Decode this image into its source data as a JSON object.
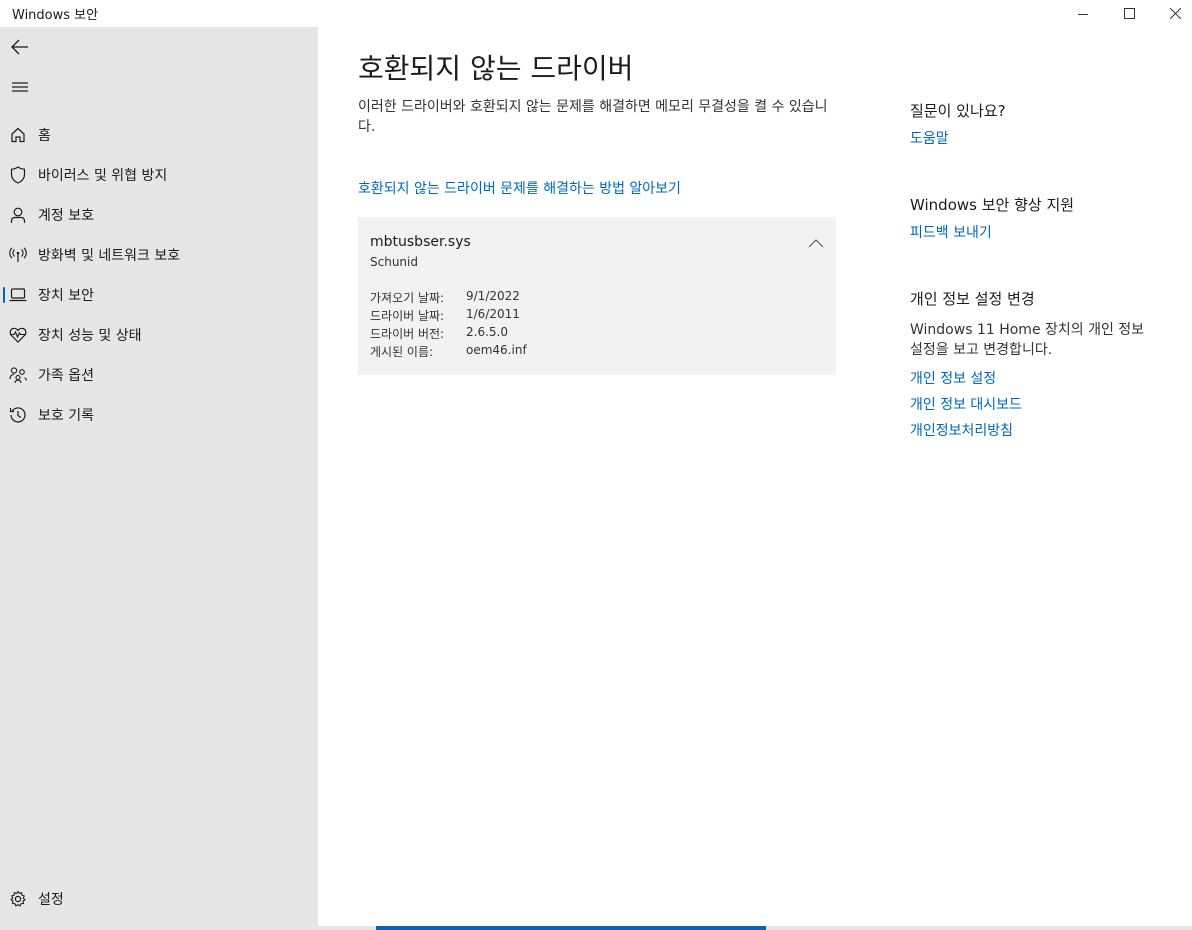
{
  "window": {
    "title": "Windows 보안"
  },
  "sidebar": {
    "items": [
      {
        "label": "홈",
        "icon": "home-icon"
      },
      {
        "label": "바이러스 및 위협 방지",
        "icon": "shield-icon"
      },
      {
        "label": "계정 보호",
        "icon": "person-icon"
      },
      {
        "label": "방화벽 및 네트워크 보호",
        "icon": "antenna-icon"
      },
      {
        "label": "장치 보안",
        "icon": "laptop-icon",
        "selected": true
      },
      {
        "label": "장치 성능 및 상태",
        "icon": "heart-pulse-icon"
      },
      {
        "label": "가족 옵션",
        "icon": "family-icon"
      },
      {
        "label": "보호 기록",
        "icon": "history-icon"
      }
    ],
    "settings_label": "설정"
  },
  "main": {
    "title": "호환되지 않는 드라이버",
    "description": "이러한 드라이버와 호환되지 않는 문제를 해결하면 메모리 무결성을 켤 수 있습니다.",
    "learn_link": "호환되지 않는 드라이버 문제를 해결하는 방법 알아보기",
    "driver": {
      "name": "mbtusbser.sys",
      "vendor": "Schunid",
      "details": [
        {
          "key": "가져오기 날짜:",
          "value": "9/1/2022"
        },
        {
          "key": "드라이버 날짜:",
          "value": "1/6/2011"
        },
        {
          "key": "드라이버 버전:",
          "value": "2.6.5.0"
        },
        {
          "key": "게시된 이름:",
          "value": "oem46.inf"
        }
      ]
    }
  },
  "side": {
    "question_heading": "질문이 있나요?",
    "help_link": "도움말",
    "improve_heading": "Windows 보안 향상 지원",
    "feedback_link": "피드백 보내기",
    "privacy_heading": "개인 정보 설정 변경",
    "privacy_text": "Windows 11 Home 장치의 개인 정보 설정을 보고 변경합니다.",
    "privacy_links": [
      "개인 정보 설정",
      "개인 정보 대시보드",
      "개인정보처리방침"
    ]
  },
  "colors": {
    "accent": "#0067c0",
    "sidebar_bg": "#e6e6e6",
    "card_bg": "#f2f2f2"
  }
}
